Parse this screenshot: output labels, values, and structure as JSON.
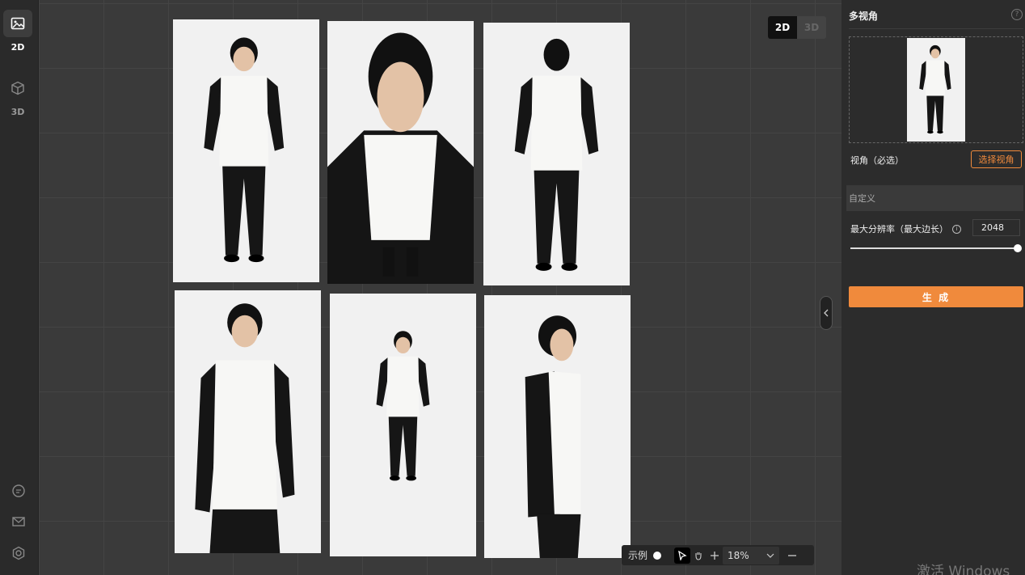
{
  "left_rail": {
    "items": [
      {
        "label": "2D",
        "icon": "image-icon",
        "active": true
      },
      {
        "label": "3D",
        "icon": "cube-icon",
        "active": false
      }
    ],
    "bottom_icons": [
      "chat-icon",
      "mail-icon",
      "settings-icon"
    ]
  },
  "canvas": {
    "mode_toggle": {
      "options": [
        "2D",
        "3D"
      ],
      "active": "2D"
    },
    "photos": [
      {
        "view": "full-body-front-looking-up"
      },
      {
        "view": "top-down-close-up"
      },
      {
        "view": "back"
      },
      {
        "view": "half-body-front"
      },
      {
        "view": "full-body-front"
      },
      {
        "view": "side-profile"
      }
    ],
    "toolbar": {
      "example_label": "示例",
      "zoom": "18%"
    }
  },
  "panel": {
    "title": "多视角",
    "view_label": "视角（必选）",
    "select_view_button": "选择视角",
    "custom_placeholder": "自定义",
    "resolution_label": "最大分辨率（最大边长）",
    "resolution_value": "2048",
    "resolution_slider_fraction": 1.0,
    "generate_button": "生 成"
  },
  "os_watermark": "激活 Windows",
  "colors": {
    "accent": "#f08a3c",
    "canvas_bg": "#3a3a3a",
    "panel_bg": "#2c2c2c"
  }
}
